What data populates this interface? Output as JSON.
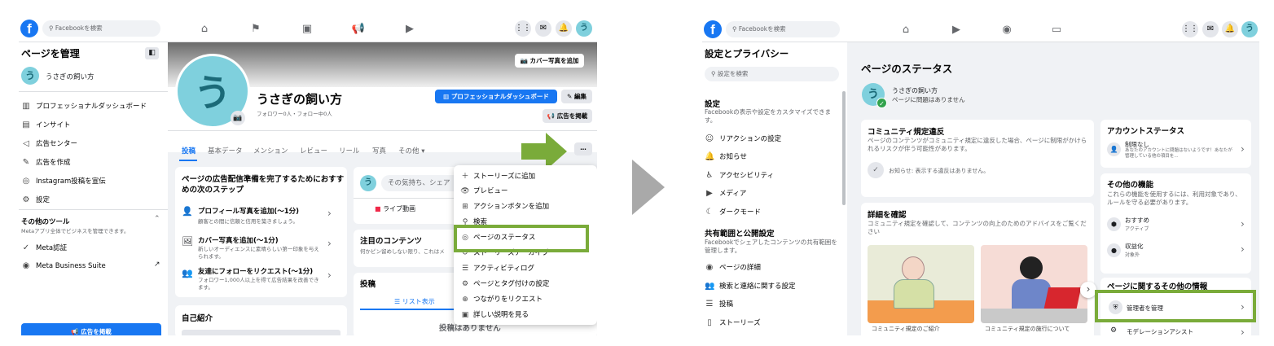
{
  "left": {
    "topbar": {
      "search_placeholder": "Facebookを検索"
    },
    "sidebar": {
      "title": "ページを管理",
      "page_name": "うさぎの飼い方",
      "avatar_char": "う",
      "items": [
        {
          "icon": "dashboard-icon",
          "label": "プロフェッショナルダッシュボード"
        },
        {
          "icon": "insights-icon",
          "label": "インサイト"
        },
        {
          "icon": "megaphone-icon",
          "label": "広告センター"
        },
        {
          "icon": "edit-ad-icon",
          "label": "広告を作成"
        },
        {
          "icon": "instagram-icon",
          "label": "Instagram投稿を宣伝"
        },
        {
          "icon": "gear-icon",
          "label": "設定"
        }
      ],
      "tools_title": "その他のツール",
      "tools_sub": "Metaアプリ全体でビジネスを管理できます。",
      "tools": [
        {
          "icon": "check-circle-icon",
          "label": "Meta認証"
        },
        {
          "icon": "meta-icon",
          "label": "Meta Business Suite"
        }
      ],
      "promote_button": "広告を掲載"
    },
    "cover": {
      "add_cover_button": "カバー写真を追加"
    },
    "profile": {
      "avatar_char": "う",
      "name": "うさぎの飼い方",
      "stats": "フォロワー0人・フォロー中0人",
      "dashboard_button": "プロフェッショナルダッシュボード",
      "edit_button": "編集",
      "promote_button": "広告を掲載"
    },
    "tabs": [
      "投稿",
      "基本データ",
      "メンション",
      "レビュー",
      "リール",
      "写真",
      "その他"
    ],
    "steps": {
      "title": "ページの広告配信準備を完了するためにおすすめの次のステップ",
      "items": [
        {
          "title": "プロフィール写真を追加(〜1分)",
          "sub": "顧客との間に信頼と信用を築きましょう。"
        },
        {
          "title": "カバー写真を追加(〜1分)",
          "sub": "新しいオーディエンスに素晴らしい第一印象を与えられます。"
        },
        {
          "title": "友達にフォローをリクエスト(〜1分)",
          "sub": "フォロワー1,000人以上を得て広告結果を改善できます。"
        }
      ]
    },
    "intro_title": "自己紹介",
    "composer": {
      "placeholder": "その気持ち、シェア",
      "live_label": "ライブ動画"
    },
    "featured": {
      "title": "注目のコンテンツ",
      "sub": "何かピン留めしない限り、これはメ"
    },
    "posts": {
      "title": "投稿",
      "list_view": "リスト表示",
      "empty": "投稿はありません"
    },
    "dropdown": {
      "more_button": "…",
      "items": [
        {
          "icon": "plus-icon",
          "label": "ストーリーズに追加"
        },
        {
          "icon": "eye-icon",
          "label": "プレビュー"
        },
        {
          "icon": "add-button-icon",
          "label": "アクションボタンを追加"
        },
        {
          "icon": "search-icon",
          "label": "検索"
        },
        {
          "icon": "status-icon",
          "label": "ページのステータス"
        },
        {
          "icon": "archive-icon",
          "label": "ストーリーズアーカイブ"
        },
        {
          "icon": "list-icon",
          "label": "アクティビティログ"
        },
        {
          "icon": "tag-icon",
          "label": "ページとタグ付けの設定"
        },
        {
          "icon": "connect-icon",
          "label": "つながりをリクエスト"
        },
        {
          "icon": "info-icon",
          "label": "詳しい説明を見る"
        }
      ]
    }
  },
  "right": {
    "topbar": {
      "search_placeholder": "Facebookを検索"
    },
    "sidebar": {
      "title": "設定とプライバシー",
      "search_placeholder": "設定を検索",
      "section1": {
        "title": "設定",
        "sub": "Facebookの表示や設定をカスタマイズできます。"
      },
      "items1": [
        {
          "icon": "reaction-icon",
          "label": "リアクションの設定"
        },
        {
          "icon": "bell-icon",
          "label": "お知らせ"
        },
        {
          "icon": "accessibility-icon",
          "label": "アクセシビリティ"
        },
        {
          "icon": "media-icon",
          "label": "メディア"
        },
        {
          "icon": "moon-icon",
          "label": "ダークモード"
        }
      ],
      "section2": {
        "title": "共有範囲と公開設定",
        "sub": "Facebookでシェアしたコンテンツの共有範囲を管理します。"
      },
      "items2": [
        {
          "icon": "page-details-icon",
          "label": "ページの詳細"
        },
        {
          "icon": "people-search-icon",
          "label": "検索と連絡に関する設定"
        },
        {
          "icon": "post-icon",
          "label": "投稿"
        },
        {
          "icon": "book-icon",
          "label": "ストーリーズ"
        }
      ]
    },
    "main": {
      "title": "ページのステータス",
      "page_name": "うさぎの飼い方",
      "page_status": "ページに問題はありません",
      "avatar_char": "う",
      "violations": {
        "title": "コミュニティ規定違反",
        "sub": "ページのコンテンツがコミュニティ規定に違反した場合、ページに制限がかけられるリスクが伴う可能性があります。",
        "notice": "お知らせ: 表示する違反はありません。"
      },
      "learn": {
        "title": "詳細を確認",
        "sub": "コミュニティ規定を確認して、コンテンツの向上のためのアドバイスをご覧ください",
        "card1": "コミュニティ規定のご紹介",
        "card2": "コミュニティ規定の施行について"
      },
      "account_status": {
        "title": "アカウントステータス",
        "item_title": "制限なし",
        "item_sub": "あなたのアカウントに問題はないようです！あなたが管理している他の項目を..."
      },
      "other_features": {
        "title": "その他の機能",
        "sub": "これらの機能を使用するには、利用対象であり、ルールを守る必要があります。",
        "items": [
          {
            "title": "おすすめ",
            "sub": "アクティブ"
          },
          {
            "title": "収益化",
            "sub": "対象外"
          }
        ]
      },
      "more_info": {
        "title": "ページに関するその他の情報",
        "items": [
          "管理者を管理",
          "モデレーションアシスト"
        ]
      }
    }
  },
  "colors": {
    "fb_blue": "#1877f2",
    "highlight_green": "#7aab3a",
    "arrow_gray": "#a9a9a9"
  }
}
